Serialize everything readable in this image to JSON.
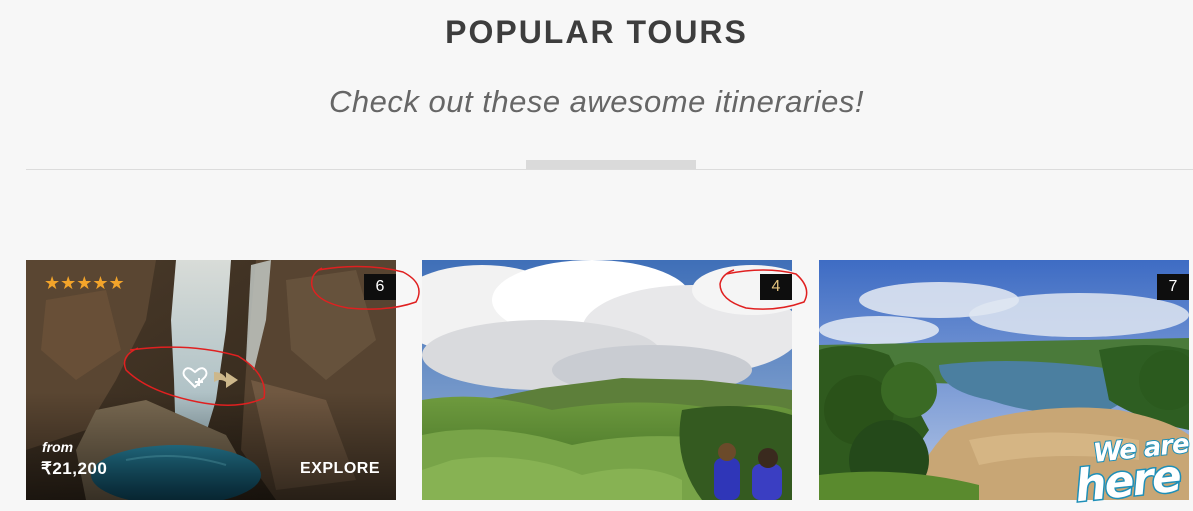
{
  "section": {
    "title": "POPULAR TOURS",
    "subtitle": "Check out these awesome itineraries!"
  },
  "tours": [
    {
      "count": "6",
      "rating_stars": "★★★★★",
      "rating": 5,
      "from_label": "from",
      "price": "₹21,200",
      "cta": "EXPLORE",
      "scene": "waterfall"
    },
    {
      "count": "4",
      "scene": "green-valley"
    },
    {
      "count": "7",
      "scene": "river-landscape"
    }
  ],
  "chat_widget": {
    "line1": "We are",
    "line2": "here"
  },
  "colors": {
    "title": "#3d3d3d",
    "star": "#f3a42a",
    "badge": "#0e0e0e",
    "annotation": "#e02020",
    "chat_outline": "#1e8fb8"
  },
  "icons": {
    "wishlist": "heart-plus-icon",
    "share": "share-arrow-icon"
  }
}
